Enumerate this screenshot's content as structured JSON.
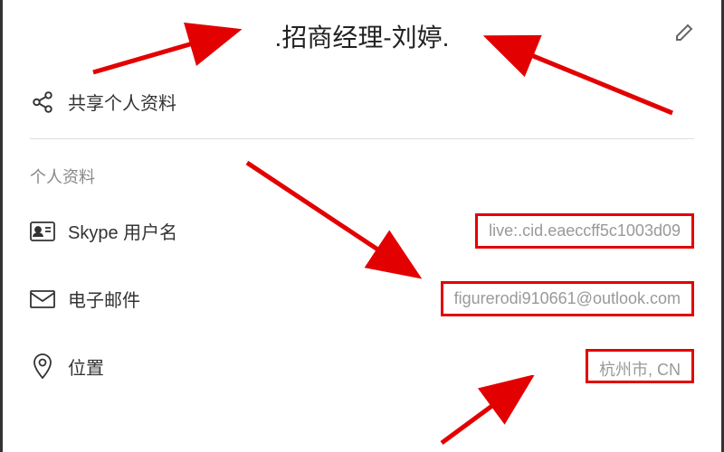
{
  "header": {
    "title": ".招商经理-刘婷."
  },
  "share": {
    "label": "共享个人资料"
  },
  "section": {
    "title": "个人资料"
  },
  "rows": {
    "skype": {
      "label": "Skype 用户名",
      "value": "live:.cid.eaeccff5c1003d09"
    },
    "email": {
      "label": "电子邮件",
      "value": "figurerodi910661@outlook.com"
    },
    "location": {
      "label": "位置",
      "value": "杭州市, CN"
    }
  }
}
